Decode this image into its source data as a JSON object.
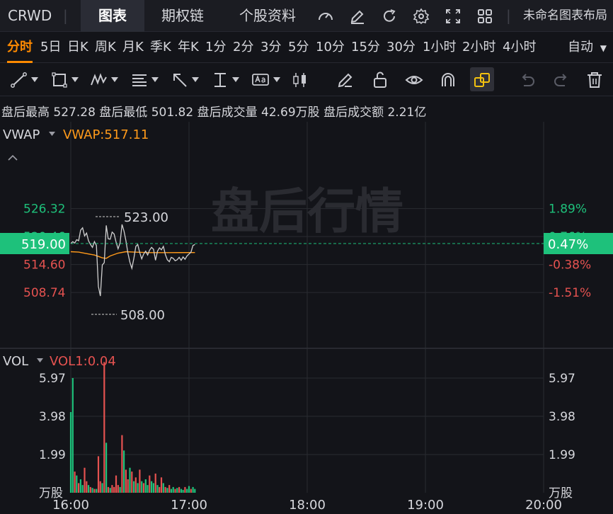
{
  "app": {
    "symbol": "CRWD",
    "tabs": [
      "图表",
      "期权链",
      "个股资料"
    ],
    "layout_name": "未命名图表布局"
  },
  "periods": {
    "items": [
      "分时",
      "5日",
      "日K",
      "周K",
      "月K",
      "季K",
      "年K",
      "1分",
      "2分",
      "3分",
      "5分",
      "10分",
      "15分",
      "30分",
      "1小时",
      "2小时",
      "4小时"
    ],
    "active": "分时",
    "scale_mode": "自动"
  },
  "stats": {
    "high_label": "盘后最高",
    "high": "527.28",
    "low_label": "盘后最低",
    "low": "501.82",
    "volume_label": "盘后成交量",
    "volume": "42.69万股",
    "turnover_label": "盘后成交额",
    "turnover": "2.21亿"
  },
  "colors": {
    "up": "#1ec17b",
    "down": "#e55250",
    "vwap": "#ff9a1a",
    "price_line": "#d0d0d0",
    "accent": "#ff8a00"
  },
  "chart_data": [
    {
      "type": "line",
      "indicator_label": "VWAP",
      "vwap_label": "VWAP:517.11",
      "watermark": "盘后行情",
      "y_ticks": [
        "526.32",
        "520.46",
        "514.60",
        "508.74"
      ],
      "pct_ticks": [
        "1.89%",
        "0.76%",
        "-0.38%",
        "-1.51%"
      ],
      "current_price": "519.00",
      "current_pct": "0.47%",
      "high_marker": "523.00",
      "low_marker": "508.00",
      "x_labels": [
        "16:00",
        "17:00",
        "18:00",
        "19:00",
        "20:00"
      ],
      "ylim": [
        505,
        530
      ],
      "x_minutes_range": [
        0,
        240
      ],
      "base": 516.55,
      "price": [
        [
          0,
          519.0
        ],
        [
          1,
          519.4
        ],
        [
          2,
          519.1
        ],
        [
          3,
          519.8
        ],
        [
          4,
          519.6
        ],
        [
          5,
          521.8
        ],
        [
          6,
          522.3
        ],
        [
          7,
          520.6
        ],
        [
          8,
          521.2
        ],
        [
          9,
          519.6
        ],
        [
          10,
          518.8
        ],
        [
          11,
          518.2
        ],
        [
          12,
          519.4
        ],
        [
          13,
          518.6
        ],
        [
          14,
          510.0
        ],
        [
          15,
          508.0
        ],
        [
          16,
          514.5
        ],
        [
          17,
          515.0
        ],
        [
          18,
          522.8
        ],
        [
          19,
          520.0
        ],
        [
          20,
          519.9
        ],
        [
          21,
          521.4
        ],
        [
          22,
          521.0
        ],
        [
          23,
          519.3
        ],
        [
          24,
          517.9
        ],
        [
          25,
          519.1
        ],
        [
          26,
          523.0
        ],
        [
          27,
          521.6
        ],
        [
          28,
          519.6
        ],
        [
          29,
          517.0
        ],
        [
          30,
          515.1
        ],
        [
          31,
          513.8
        ],
        [
          32,
          515.9
        ],
        [
          33,
          518.4
        ],
        [
          34,
          518.8
        ],
        [
          35,
          517.1
        ],
        [
          36,
          515.8
        ],
        [
          37,
          516.8
        ],
        [
          38,
          517.4
        ],
        [
          39,
          516.6
        ],
        [
          40,
          517.6
        ],
        [
          41,
          518.2
        ],
        [
          42,
          517.8
        ],
        [
          43,
          515.5
        ],
        [
          44,
          517.4
        ],
        [
          45,
          518.1
        ],
        [
          46,
          517.7
        ],
        [
          47,
          518.4
        ],
        [
          48,
          516.7
        ],
        [
          49,
          515.6
        ],
        [
          50,
          515.2
        ],
        [
          51,
          516.1
        ],
        [
          52,
          515.9
        ],
        [
          53,
          515.4
        ],
        [
          54,
          515.6
        ],
        [
          55,
          516.1
        ],
        [
          56,
          515.5
        ],
        [
          57,
          516.2
        ],
        [
          58,
          515.7
        ],
        [
          59,
          516.4
        ],
        [
          60,
          516.8
        ],
        [
          61,
          517.2
        ],
        [
          62,
          518.6
        ],
        [
          63,
          518.8
        ]
      ],
      "vwap": [
        [
          0,
          517.3
        ],
        [
          4,
          517.2
        ],
        [
          8,
          516.9
        ],
        [
          12,
          516.6
        ],
        [
          14,
          516.3
        ],
        [
          16,
          516.0
        ],
        [
          18,
          515.9
        ],
        [
          20,
          516.4
        ],
        [
          24,
          517.0
        ],
        [
          28,
          517.3
        ],
        [
          32,
          517.2
        ],
        [
          40,
          517.1
        ],
        [
          50,
          517.1
        ],
        [
          63,
          517.11
        ]
      ]
    },
    {
      "type": "bar",
      "indicator_label": "VOL",
      "vol_label": "VOL1:0.04",
      "y_ticks": [
        "5.97",
        "3.98",
        "1.99"
      ],
      "unit": "万股",
      "ylim": [
        0,
        7.0
      ],
      "bars": [
        [
          0,
          4.2,
          "up"
        ],
        [
          1,
          5.97,
          "up"
        ],
        [
          2,
          1.1,
          "down"
        ],
        [
          3,
          0.9,
          "up"
        ],
        [
          4,
          0.5,
          "down"
        ],
        [
          5,
          0.7,
          "up"
        ],
        [
          6,
          0.4,
          "up"
        ],
        [
          7,
          1.3,
          "down"
        ],
        [
          8,
          0.6,
          "down"
        ],
        [
          9,
          0.4,
          "up"
        ],
        [
          10,
          0.3,
          "down"
        ],
        [
          11,
          0.25,
          "up"
        ],
        [
          12,
          0.2,
          "down"
        ],
        [
          13,
          0.2,
          "up"
        ],
        [
          14,
          1.9,
          "down"
        ],
        [
          15,
          0.6,
          "down"
        ],
        [
          16,
          0.5,
          "up"
        ],
        [
          17,
          6.8,
          "down"
        ],
        [
          18,
          2.6,
          "up"
        ],
        [
          19,
          0.3,
          "down"
        ],
        [
          20,
          0.25,
          "up"
        ],
        [
          21,
          0.4,
          "down"
        ],
        [
          22,
          0.3,
          "down"
        ],
        [
          23,
          0.9,
          "down"
        ],
        [
          24,
          0.4,
          "down"
        ],
        [
          25,
          0.3,
          "up"
        ],
        [
          26,
          3.0,
          "down"
        ],
        [
          27,
          2.2,
          "up"
        ],
        [
          28,
          1.2,
          "down"
        ],
        [
          29,
          0.7,
          "down"
        ],
        [
          30,
          1.3,
          "up"
        ],
        [
          31,
          1.1,
          "down"
        ],
        [
          32,
          0.6,
          "up"
        ],
        [
          33,
          0.8,
          "down"
        ],
        [
          34,
          0.5,
          "up"
        ],
        [
          35,
          1.2,
          "down"
        ],
        [
          36,
          0.6,
          "up"
        ],
        [
          37,
          0.5,
          "down"
        ],
        [
          38,
          0.7,
          "up"
        ],
        [
          39,
          0.4,
          "up"
        ],
        [
          40,
          0.9,
          "down"
        ],
        [
          41,
          0.6,
          "up"
        ],
        [
          42,
          0.5,
          "up"
        ],
        [
          43,
          1.0,
          "down"
        ],
        [
          44,
          0.4,
          "up"
        ],
        [
          45,
          0.3,
          "down"
        ],
        [
          46,
          0.8,
          "down"
        ],
        [
          47,
          0.5,
          "up"
        ],
        [
          48,
          0.3,
          "down"
        ],
        [
          49,
          0.25,
          "up"
        ],
        [
          50,
          0.4,
          "down"
        ],
        [
          51,
          0.2,
          "up"
        ],
        [
          52,
          0.3,
          "up"
        ],
        [
          53,
          0.2,
          "down"
        ],
        [
          54,
          0.25,
          "up"
        ],
        [
          55,
          0.3,
          "down"
        ],
        [
          56,
          0.2,
          "up"
        ],
        [
          57,
          0.15,
          "up"
        ],
        [
          58,
          0.3,
          "down"
        ],
        [
          59,
          0.2,
          "up"
        ],
        [
          60,
          0.35,
          "up"
        ],
        [
          61,
          0.2,
          "down"
        ],
        [
          62,
          0.3,
          "up"
        ],
        [
          63,
          0.2,
          "up"
        ]
      ]
    }
  ]
}
